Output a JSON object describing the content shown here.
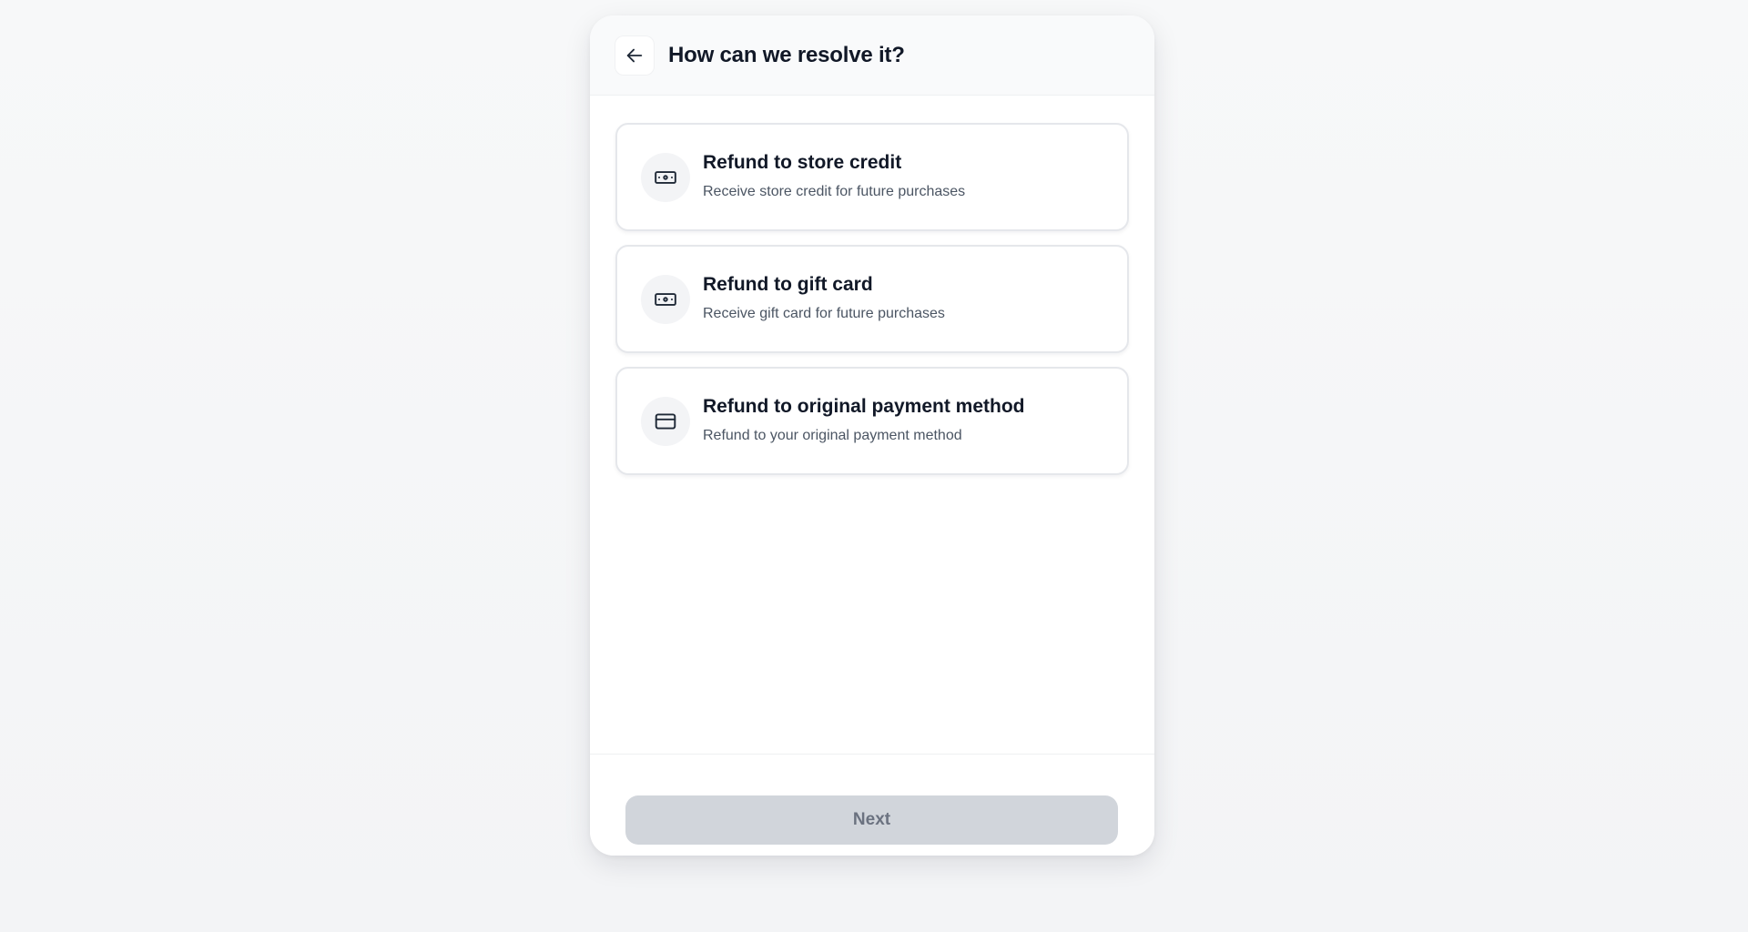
{
  "header": {
    "title": "How can we resolve it?",
    "back_icon": "arrow-left-icon"
  },
  "options": [
    {
      "title": "Refund to store credit",
      "description": "Receive store credit for future purchases",
      "icon": "banknote-icon"
    },
    {
      "title": "Refund to gift card",
      "description": "Receive gift card for future purchases",
      "icon": "banknote-icon"
    },
    {
      "title": "Refund to original payment method",
      "description": "Refund to your original payment method",
      "icon": "credit-card-icon"
    }
  ],
  "footer": {
    "next_label": "Next",
    "next_state": "disabled"
  },
  "colors": {
    "background": "#f3f4f6",
    "card": "#ffffff",
    "text_primary": "#111827",
    "text_secondary": "#4b5563",
    "button_disabled_bg": "#d1d5db",
    "button_disabled_text": "#6b7280"
  }
}
